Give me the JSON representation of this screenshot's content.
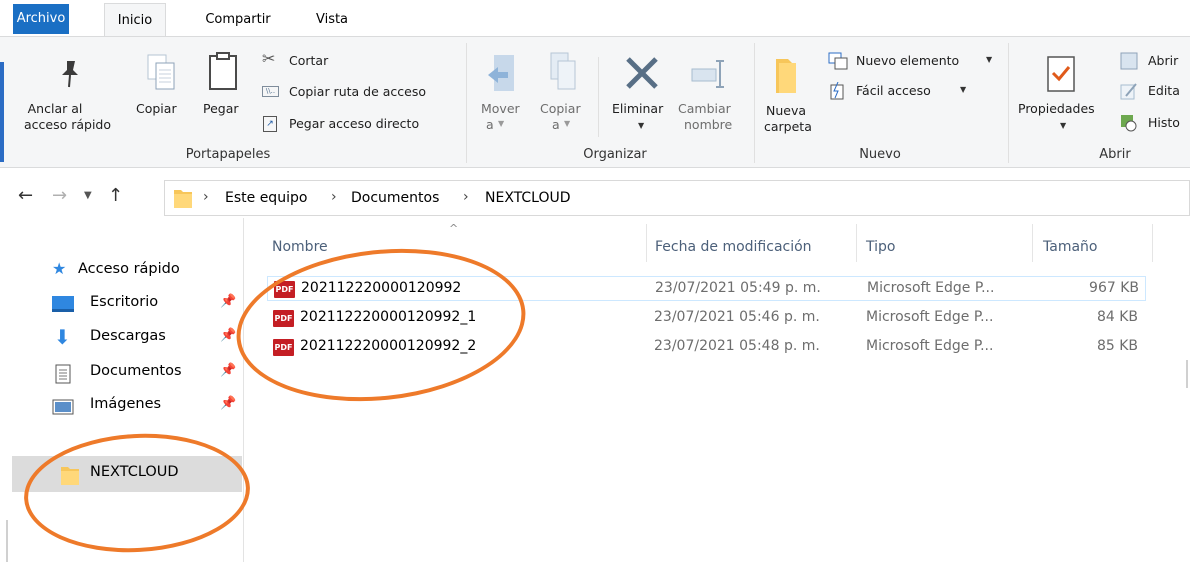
{
  "tabs": {
    "file": "Archivo",
    "home": "Inicio",
    "share": "Compartir",
    "view": "Vista"
  },
  "ribbon": {
    "clipboard": {
      "pin_label_1": "Anclar al",
      "pin_label_2": "acceso rápido",
      "copy": "Copiar",
      "paste": "Pegar",
      "cut": "Cortar",
      "copy_path": "Copiar ruta de acceso",
      "paste_shortcut": "Pegar acceso directo",
      "group": "Portapapeles"
    },
    "organize": {
      "move_1": "Mover",
      "move_2": "a",
      "copy_1": "Copiar",
      "copy_2": "a",
      "delete": "Eliminar",
      "rename_1": "Cambiar",
      "rename_2": "nombre",
      "group": "Organizar"
    },
    "new": {
      "folder_1": "Nueva",
      "folder_2": "carpeta",
      "new_item": "Nuevo elemento",
      "easy_access": "Fácil acceso",
      "group": "Nuevo"
    },
    "open": {
      "properties": "Propiedades",
      "open": "Abrir",
      "edit": "Edita",
      "history": "Histo",
      "group": "Abrir"
    }
  },
  "breadcrumb": [
    "Este equipo",
    "Documentos",
    "NEXTCLOUD"
  ],
  "nav": {
    "quick_access": "Acceso rápido",
    "items": [
      "Escritorio",
      "Descargas",
      "Documentos",
      "Imágenes"
    ],
    "nextcloud": "NEXTCLOUD"
  },
  "columns": {
    "name": "Nombre",
    "date": "Fecha de modificación",
    "type": "Tipo",
    "size": "Tamaño"
  },
  "files": [
    {
      "name": "202112220000120992",
      "date": "23/07/2021 05:49 p. m.",
      "type": "Microsoft Edge P...",
      "size": "967 KB"
    },
    {
      "name": "202112220000120992_1",
      "date": "23/07/2021 05:46 p. m.",
      "type": "Microsoft Edge P...",
      "size": "84 KB"
    },
    {
      "name": "202112220000120992_2",
      "date": "23/07/2021 05:48 p. m.",
      "type": "Microsoft Edge P...",
      "size": "85 KB"
    }
  ],
  "pdf_badge": "PDF",
  "colors": {
    "accent": "#1a6fc4",
    "annotation": "#ee7a2a",
    "pdf": "#c41e24",
    "folder": "#f7c65a"
  }
}
